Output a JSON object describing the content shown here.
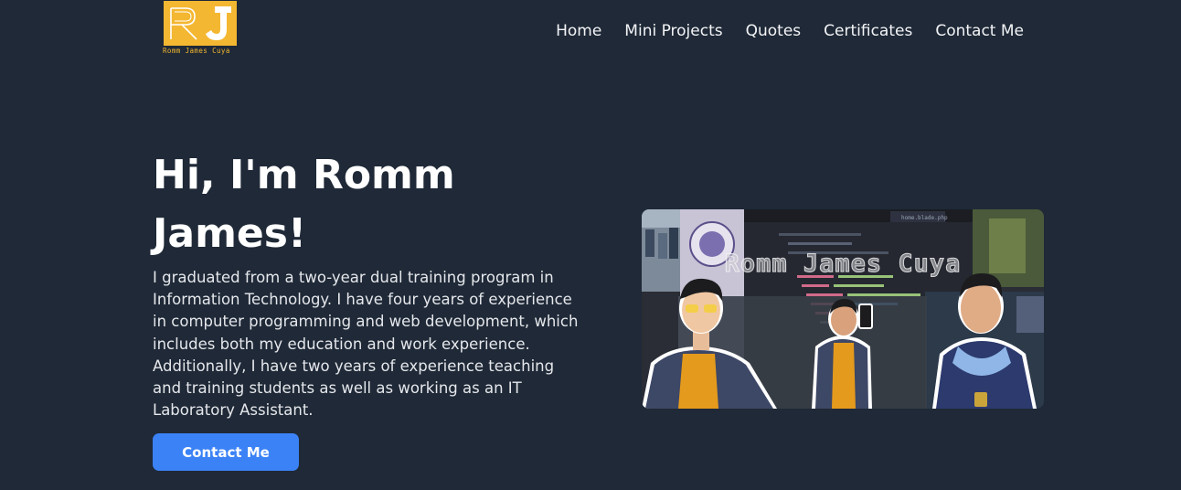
{
  "brand": {
    "logo_letters": "RJ",
    "logo_caption": "Romm James Cuya",
    "accent_color": "#f4b731"
  },
  "nav": {
    "items": [
      {
        "label": "Home"
      },
      {
        "label": "Mini Projects"
      },
      {
        "label": "Quotes"
      },
      {
        "label": "Certificates"
      },
      {
        "label": "Contact Me"
      }
    ]
  },
  "hero": {
    "title": "Hi, I'm Romm James!",
    "description": "I graduated from a two-year dual training program in Information Technology. I have four years of experience in computer programming and web development, which includes both my education and work experience. Additionally, I have two years of experience teaching and training students as well as working as an IT Laboratory Assistant.",
    "cta_label": "Contact Me",
    "cta_color": "#3b82f6",
    "image": {
      "overlay_text": "Romm James Cuya",
      "editor_tab": "home.blade.php"
    }
  },
  "colors": {
    "background": "#1f2937",
    "text": "#ffffff"
  }
}
